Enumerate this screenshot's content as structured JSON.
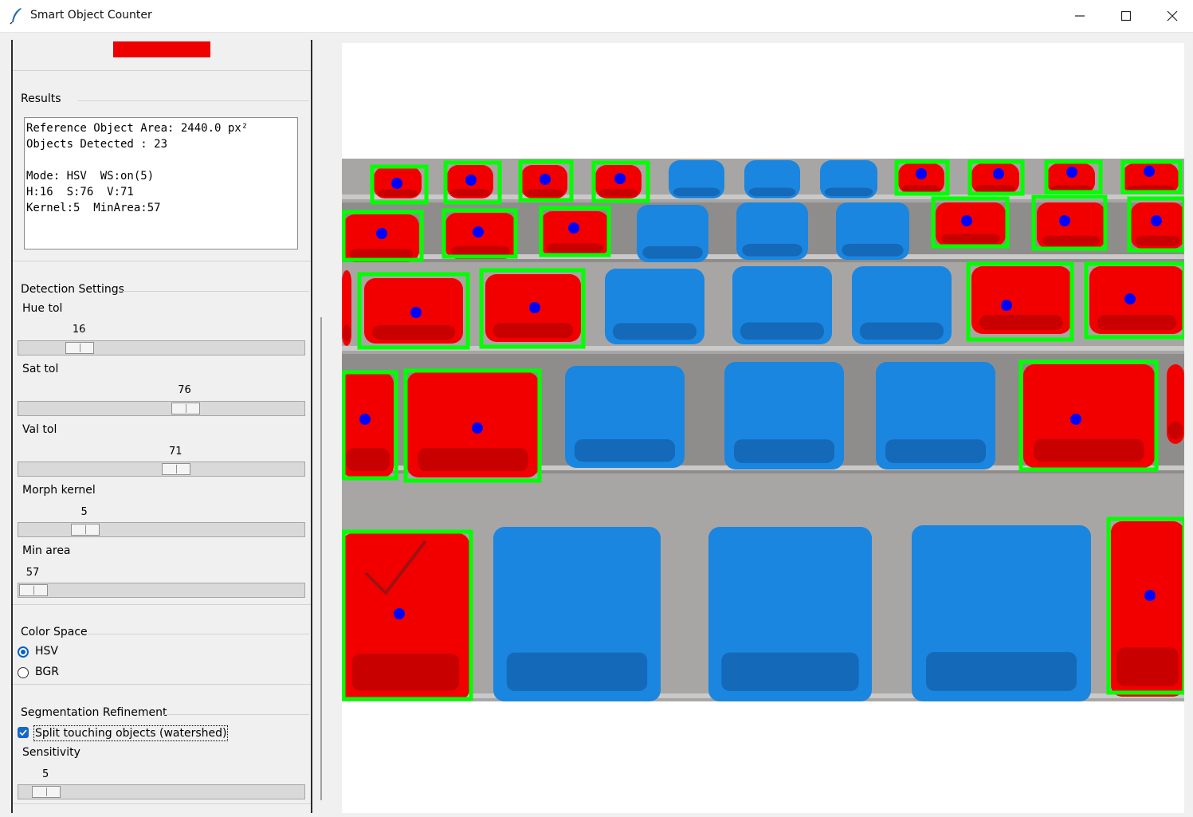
{
  "window": {
    "title": "Smart Object Counter"
  },
  "results": {
    "label": "Results",
    "text": "Reference Object Area: 2440.0 px²\nObjects Detected : 23\n\nMode: HSV  WS:on(5)\nH:16  S:76  V:71\nKernel:5  MinArea:57"
  },
  "reference_color": "#ee0000",
  "detection": {
    "label": "Detection Settings",
    "hue": {
      "label": "Hue tol",
      "value": "16",
      "fraction": 0.18
    },
    "sat": {
      "label": "Sat tol",
      "value": "76",
      "fraction": 0.59
    },
    "val": {
      "label": "Val tol",
      "value": "71",
      "fraction": 0.555
    },
    "kernel": {
      "label": "Morph kernel",
      "value": "5",
      "fraction": 0.2
    },
    "min_area": {
      "label": "Min area",
      "value": "57",
      "fraction": 0.0
    }
  },
  "color_space": {
    "label": "Color Space",
    "options": [
      "HSV",
      "BGR"
    ],
    "selected": "HSV"
  },
  "segmentation": {
    "label": "Segmentation Refinement",
    "checkbox_label": "Split touching objects (watershed)",
    "checked": true,
    "sensitivity": {
      "label": "Sensitivity",
      "value": "5",
      "fraction": 0.05
    }
  },
  "image": {
    "box_color": "#00ff00",
    "centroid_color": "#0000ff",
    "red_seat_color": "#f20000",
    "blue_seat_color": "#1a86e0"
  }
}
